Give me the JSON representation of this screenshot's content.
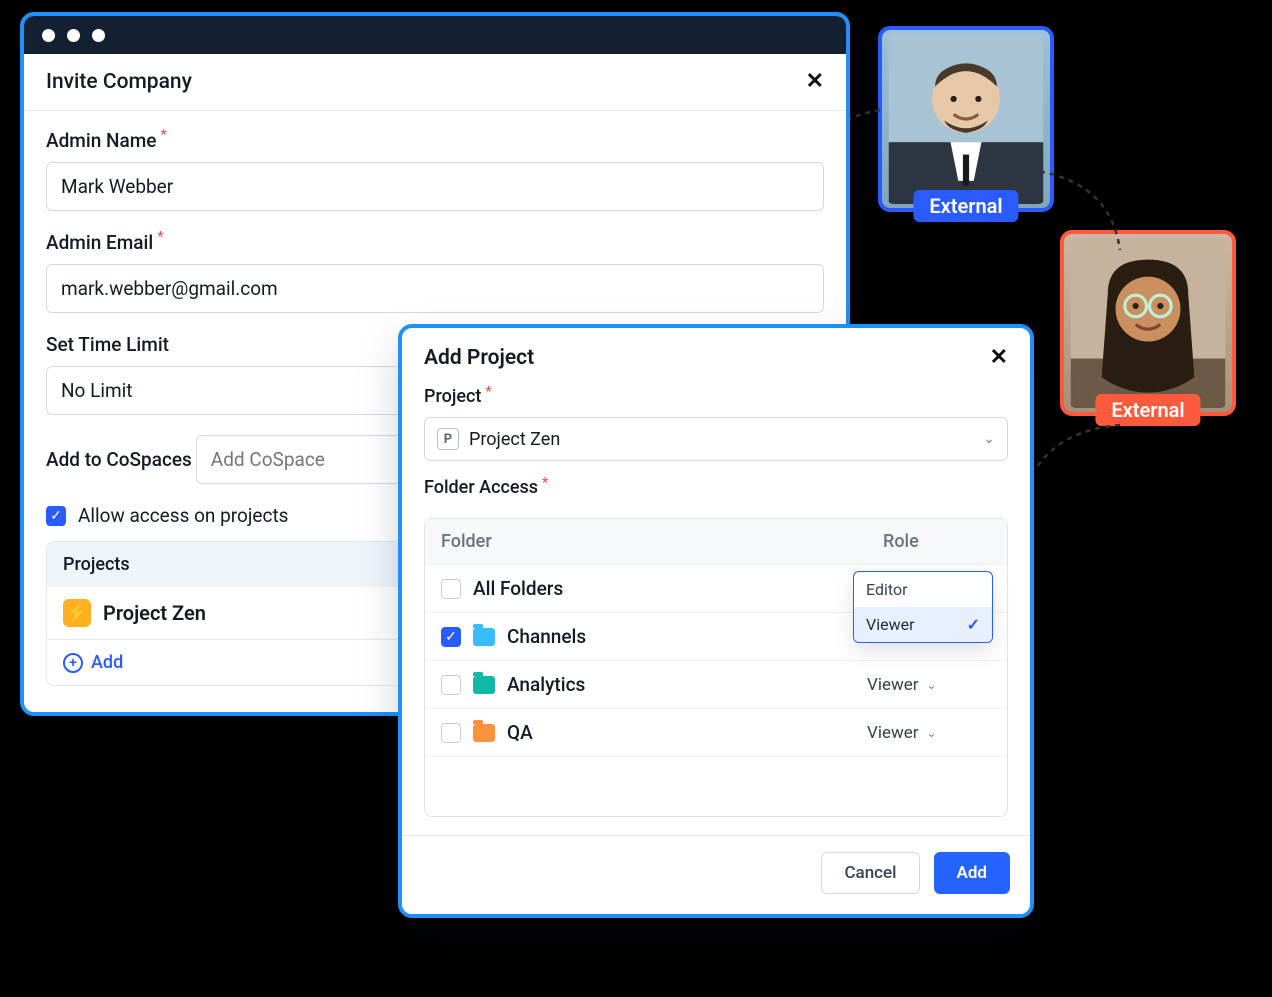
{
  "invite": {
    "title": "Invite Company",
    "admin_name_label": "Admin Name",
    "admin_name_value": "Mark Webber",
    "admin_email_label": "Admin Email",
    "admin_email_value": "mark.webber@gmail.com",
    "time_limit_label": "Set Time Limit",
    "time_limit_value": "No Limit",
    "cospaces_label": "Add to CoSpaces",
    "cospaces_placeholder": "Add CoSpace",
    "allow_projects_label": "Allow access on projects",
    "projects_header": "Projects",
    "project_item": "Project Zen",
    "add_label": "Add"
  },
  "add_project": {
    "title": "Add Project",
    "project_label": "Project",
    "project_value": "Project Zen",
    "folder_access_label": "Folder Access",
    "col_folder": "Folder",
    "col_role": "Role",
    "rows": {
      "all": {
        "name": "All Folders",
        "role": "Viewer"
      },
      "channels": {
        "name": "Channels",
        "role": "Viewer"
      },
      "analytics": {
        "name": "Analytics",
        "role": "Viewer"
      },
      "qa": {
        "name": "QA",
        "role": "Viewer"
      }
    },
    "dropdown": {
      "editor": "Editor",
      "viewer": "Viewer"
    },
    "cancel": "Cancel",
    "add": "Add"
  },
  "external_badge": "External"
}
